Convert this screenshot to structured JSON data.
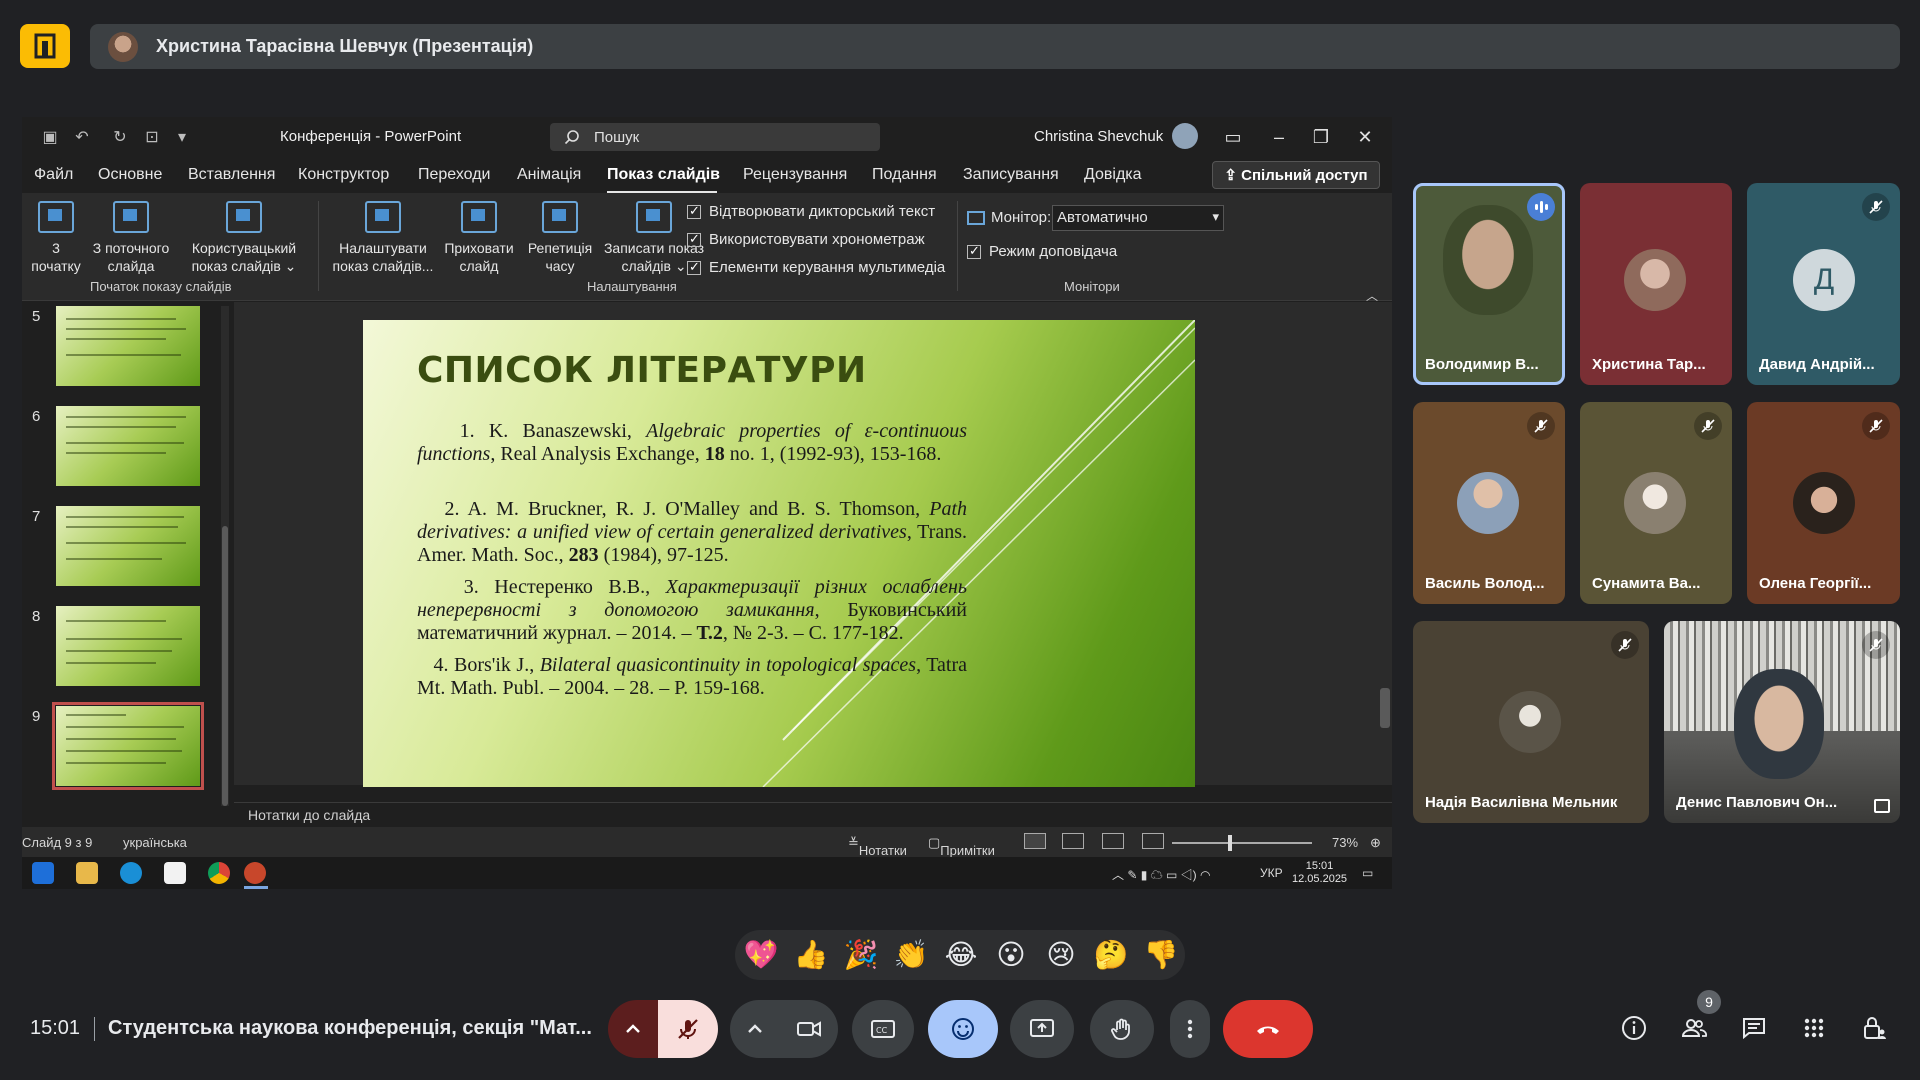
{
  "presenter": {
    "name": "Христина Тарасівна Шевчук (Презентація)"
  },
  "ppt": {
    "doc_title": "Конференція",
    "app_sep": "-",
    "app_name": "PowerPoint",
    "search_placeholder": "Пошук",
    "user_name": "Christina Shevchuk",
    "tabs": [
      "Файл",
      "Основне",
      "Вставлення",
      "Конструктор",
      "Переходи",
      "Анімація",
      "Показ слайдів",
      "Рецензування",
      "Подання",
      "Записування",
      "Довідка"
    ],
    "active_tab": "Показ слайдів",
    "share_label": "Спільний доступ",
    "ribbon": {
      "from_start": [
        "3",
        "початку"
      ],
      "from_current": [
        "З поточного",
        "слайда"
      ],
      "custom_show": [
        "Користувацький",
        "показ слайдів ⌄"
      ],
      "group_start": "Початок показу слайдів",
      "setup_show": [
        "Налаштувати",
        "показ слайдів..."
      ],
      "hide_slide": [
        "Приховати",
        "слайд"
      ],
      "rehearse": [
        "Репетиція",
        "часу"
      ],
      "record": [
        "Записати показ",
        "слайдів ⌄"
      ],
      "checks": [
        "Відтворювати дикторський текст",
        "Використовувати хронометраж",
        "Елементи керування мультимедіа"
      ],
      "group_setup": "Налаштування",
      "monitor_label": "Монітор:",
      "monitor_value": "Автоматично",
      "presenter_view": "Режим доповідача",
      "group_monitors": "Монітори"
    },
    "thumbnails": [
      "5",
      "6",
      "7",
      "8",
      "9"
    ],
    "selected_thumbnail": "9",
    "notes_placeholder": "Нотатки до слайда",
    "status": {
      "slide_info": "Слайд 9 з 9",
      "language": "українська",
      "notes": "Нотатки",
      "comments": "Примітки",
      "zoom": "73%"
    },
    "taskbar": {
      "lang": "УКР",
      "time": "15:01",
      "date": "12.05.2025"
    }
  },
  "slide": {
    "title": "СПИСОК ЛІТЕРАТУРИ",
    "refs": [
      {
        "plain_a": "1. K. Banaszewski, ",
        "italic": "Algebraic properties of ε-continuous functions",
        "plain_b": ", Real Analysis Exchange, ",
        "bold": "18",
        "plain_c": " no. 1, (1992-93), 153-168."
      },
      {
        "plain_a": "2. A. M. Bruckner, R. J. O'Malley and B. S. Thomson, ",
        "italic": "Path derivatives: a unified view of certain generalized derivatives",
        "plain_b": ", Trans. Amer. Math. Soc., ",
        "bold": "283",
        "plain_c": " (1984), 97-125."
      },
      {
        "plain_a": "3. Нестеренко В.В., ",
        "italic": "Характеризації різних ослаблень неперервності з допомогою замикання",
        "plain_b": ", Буковинський математичний журнал. – 2014. – ",
        "bold": "Т.2",
        "plain_c": ", № 2-3. – С. 177-182."
      },
      {
        "plain_a": "4. Bors'ik J., ",
        "italic": "Bilateral quasicontinuity in topological spaces",
        "plain_b": ", Tatra Mt. Math. Publ. – 2004. – 28. – P. 159-168.",
        "bold": "",
        "plain_c": ""
      }
    ]
  },
  "participants": [
    {
      "name": "Володимир В...",
      "bg": "#4d5a3a",
      "state": "speaking"
    },
    {
      "name": "Христина Тар...",
      "bg": "#7a2f34",
      "state": "none"
    },
    {
      "name": "Давид Андрій...",
      "bg": "#2f5a66",
      "state": "muted",
      "initial": "Д"
    },
    {
      "name": "Василь Волод...",
      "bg": "#6b4a2c",
      "state": "muted"
    },
    {
      "name": "Сунамита Ва...",
      "bg": "#5a5436",
      "state": "muted"
    },
    {
      "name": "Олена Георгії...",
      "bg": "#6b3a25",
      "state": "muted"
    },
    {
      "name": "Надія Василівна Мельник",
      "bg": "#4a4234",
      "state": "muted"
    },
    {
      "name": "Денис Павлович Он...",
      "bg": "#5a5a58",
      "state": "muted"
    }
  ],
  "reactions": [
    "💖",
    "👍",
    "🎉",
    "👏",
    "😂",
    "😮",
    "😢",
    "🤔",
    "👎"
  ],
  "bottom": {
    "time": "15:01",
    "meeting_title": "Студентська наукова конференція, секція \"Мат...",
    "participant_count": "9"
  },
  "colors": {
    "hangup": "#dc362e",
    "mic_off": "#f9dedc",
    "reaction_on": "#a8c7fa",
    "speaker_ring": "#a8c7fa"
  }
}
